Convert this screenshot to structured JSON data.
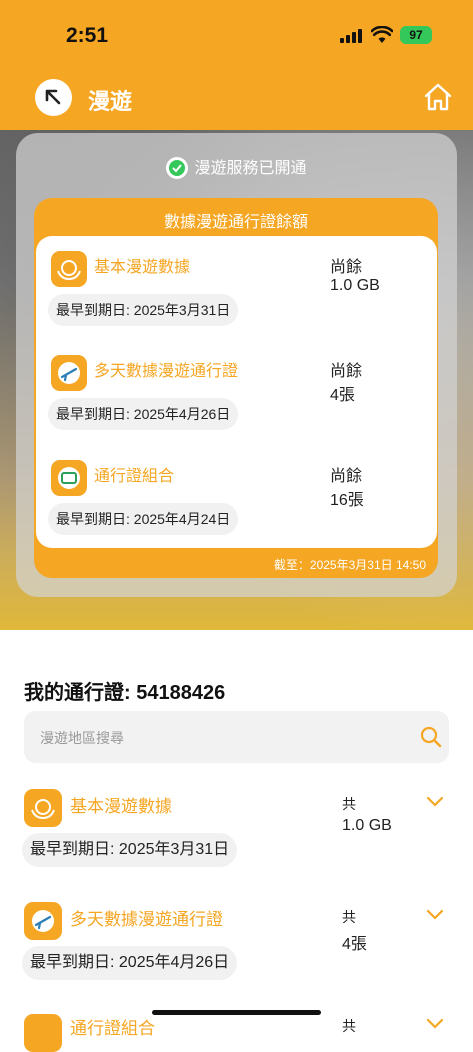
{
  "status_bar": {
    "time": "2:51",
    "battery": "97"
  },
  "header": {
    "title": "漫遊"
  },
  "service": {
    "status": "漫遊服務已開通"
  },
  "balance": {
    "title": "數據漫遊通行證餘額",
    "as_of": "截至：2025年3月31日 14:50",
    "items": [
      {
        "name": "基本漫遊數據",
        "remaining_label": "尚餘",
        "remaining_value": "1.0 GB",
        "expiry": "最早到期日: 2025年3月31日",
        "icon": "globe-hands-icon"
      },
      {
        "name": "多天數據漫遊通行證",
        "remaining_label": "尚餘",
        "remaining_value": "4張",
        "expiry": "最早到期日: 2025年4月26日",
        "icon": "plane-icon"
      },
      {
        "name": "通行證組合",
        "remaining_label": "尚餘",
        "remaining_value": "16張",
        "expiry": "最早到期日: 2025年4月24日",
        "icon": "ticket-icon"
      }
    ]
  },
  "my_passes": {
    "title": "我的通行證: 54188426",
    "search_placeholder": "漫遊地區搜尋",
    "items": [
      {
        "name": "基本漫遊數據",
        "total_label": "共",
        "total_value": "1.0 GB",
        "expiry": "最早到期日: 2025年3月31日"
      },
      {
        "name": "多天數據漫遊通行證",
        "total_label": "共",
        "total_value": "4張",
        "expiry": "最早到期日: 2025年4月26日"
      },
      {
        "name": "通行證組合",
        "total_label": "共",
        "total_value": ""
      }
    ]
  },
  "colors": {
    "accent": "#f5a623",
    "success": "#34c759"
  }
}
